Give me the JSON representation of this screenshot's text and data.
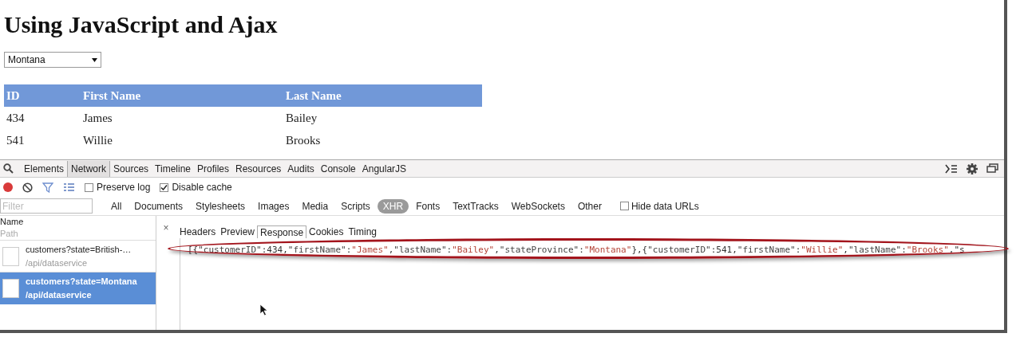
{
  "page": {
    "heading": "Using JavaScript and Ajax",
    "state_select": {
      "value": "Montana"
    },
    "table": {
      "columns": [
        "ID",
        "First Name",
        "Last Name"
      ],
      "rows": [
        [
          "434",
          "James",
          "Bailey"
        ],
        [
          "541",
          "Willie",
          "Brooks"
        ]
      ]
    }
  },
  "devtools": {
    "panel_tabs": [
      {
        "label": "Elements",
        "selected": false
      },
      {
        "label": "Network",
        "selected": true
      },
      {
        "label": "Sources",
        "selected": false
      },
      {
        "label": "Timeline",
        "selected": false
      },
      {
        "label": "Profiles",
        "selected": false
      },
      {
        "label": "Resources",
        "selected": false
      },
      {
        "label": "Audits",
        "selected": false
      },
      {
        "label": "Console",
        "selected": false
      },
      {
        "label": "AngularJS",
        "selected": false
      }
    ],
    "options": [
      {
        "label": "Preserve log",
        "checked": false
      },
      {
        "label": "Disable cache",
        "checked": true
      }
    ],
    "filter": {
      "placeholder": "Filter"
    },
    "type_filters": [
      {
        "label": "All",
        "selected": false
      },
      {
        "label": "Documents",
        "selected": false
      },
      {
        "label": "Stylesheets",
        "selected": false
      },
      {
        "label": "Images",
        "selected": false
      },
      {
        "label": "Media",
        "selected": false
      },
      {
        "label": "Scripts",
        "selected": false
      },
      {
        "label": "XHR",
        "selected": true
      },
      {
        "label": "Fonts",
        "selected": false
      },
      {
        "label": "TextTracks",
        "selected": false
      },
      {
        "label": "WebSockets",
        "selected": false
      },
      {
        "label": "Other",
        "selected": false
      }
    ],
    "hide_data_urls": {
      "label": "Hide data URLs",
      "checked": false
    },
    "request_list": {
      "name_heading": "Name",
      "path_heading": "Path",
      "requests": [
        {
          "name": "customers?state=British-…",
          "path": "/api/dataservice",
          "selected": false
        },
        {
          "name": "customers?state=Montana",
          "path": "/api/dataservice",
          "selected": true
        }
      ]
    },
    "detail": {
      "close": "×",
      "tabs": [
        {
          "label": "Headers",
          "selected": false
        },
        {
          "label": "Preview",
          "selected": false
        },
        {
          "label": "Response",
          "selected": true
        },
        {
          "label": "Cookies",
          "selected": false
        },
        {
          "label": "Timing",
          "selected": false
        }
      ],
      "response": "[{\"customerID\":434,\"firstName\":\"James\",\"lastName\":\"Bailey\",\"stateProvince\":\"Montana\"},{\"customerID\":541,\"firstName\":\"Willie\",\"lastName\":\"Brooks\",\"s"
    }
  }
}
